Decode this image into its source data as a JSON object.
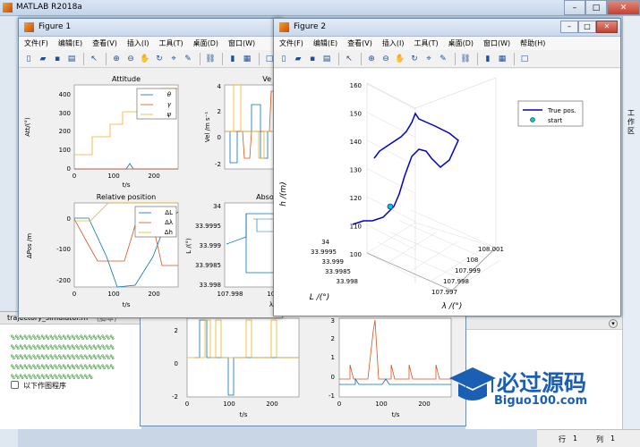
{
  "app": {
    "title": "MATLAB R2018a"
  },
  "figure1": {
    "title": "Figure 1",
    "menu": [
      "文件(F)",
      "编辑(E)",
      "查看(V)",
      "插入(I)",
      "工具(T)",
      "桌面(D)",
      "窗口(W)"
    ],
    "attitude": {
      "title": "Attitude",
      "ylabel": "Att/(°)",
      "xlabel": "t/s",
      "yticks": [
        "0",
        "100",
        "200",
        "300",
        "400"
      ],
      "xticks": [
        "0",
        "100",
        "200"
      ],
      "legend": [
        "θ",
        "γ",
        "ψ"
      ]
    },
    "velocity": {
      "title": "Ve",
      "ylabel": "Vel /m s⁻¹",
      "yticks": [
        "-2",
        "0",
        "2",
        "4"
      ]
    },
    "relpos": {
      "title": "Relative position",
      "ylabel": "ΔPos /m",
      "xlabel": "t/s",
      "yticks": [
        "-200",
        "-100",
        "0"
      ],
      "xticks": [
        "0",
        "100",
        "200"
      ],
      "legend": [
        "ΔL",
        "Δλ",
        "Δh"
      ]
    },
    "abspos": {
      "title": "Absolu",
      "ylabel": "L /(°)",
      "yticks": [
        "34",
        "33.9995",
        "33.999",
        "33.9985",
        "33.998"
      ],
      "xticks": [
        "107.998",
        "107"
      ],
      "xlabel": "λ"
    }
  },
  "figure2": {
    "title": "Figure 2",
    "menu": [
      "文件(F)",
      "编辑(E)",
      "查看(V)",
      "插入(I)",
      "工具(T)",
      "桌面(D)",
      "窗口(W)",
      "帮助(H)"
    ],
    "plot3": {
      "zlabel": "h /(m)",
      "ylabel": "L /(°)",
      "xlabel": "λ /(°)",
      "zticks": [
        "100",
        "110",
        "120",
        "130",
        "140",
        "150",
        "160"
      ],
      "yticks": [
        "34",
        "33.9995",
        "33.999",
        "33.9985",
        "33.998"
      ],
      "xticks": [
        "107.997",
        "107.998",
        "107.999",
        "108",
        "108.001"
      ],
      "legend": [
        "True pos.",
        "start"
      ],
      "line_color": "#0000cc",
      "start_color": "#00cccc"
    }
  },
  "editor": {
    "file_tab": "trajectory_simulator.m",
    "file_suffix": "(脚本)",
    "lines": [
      "%%%%%%%%%%%%%%%%%%%%%%%%",
      "%%%%%%%%%%%%%%%%%%%%%%%%",
      "%%%%%%%%%%%%%%%%%%%%%%%%",
      "%%%%%%%%%%%%%%%%%%%%%%%%",
      "%%%%%%%%%%%%%%%%%%%"
    ],
    "func_label": "以下作图程序"
  },
  "bottom_fig": {
    "left_yticks": [
      "2",
      "0",
      "-2"
    ],
    "left_xticks": [
      "0",
      "100",
      "200"
    ],
    "left_xlabel": "t/s",
    "right_yticks": [
      "3",
      "2",
      "1",
      "0",
      "-1"
    ],
    "right_xticks": [
      "0",
      "100",
      "200"
    ],
    "right_xlabel": "t/s"
  },
  "right_panel": {
    "label": "工作区"
  },
  "status": {
    "row_label": "行",
    "row": "1",
    "col_label": "列",
    "col": "1"
  },
  "watermark": {
    "cn": "必过源码",
    "en": "Biguo100.com"
  }
}
